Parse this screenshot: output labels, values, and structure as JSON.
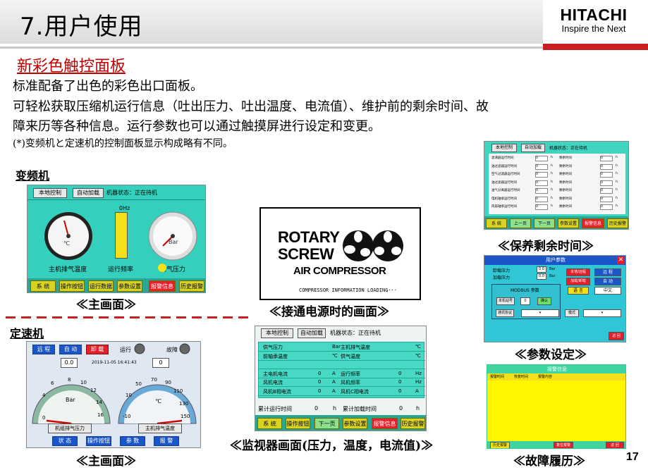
{
  "header": {
    "title": "7.用户使用",
    "logo_name": "HITACHI",
    "logo_tagline": "Inspire the Next"
  },
  "intro": {
    "subtitle": "新彩色触控面板",
    "line1": "标准配备了出色的彩色出口面板。",
    "line2": "可轻松获取压缩机运行信息（吐出压力、吐出温度、电流值）、维护前的剩余时间、故",
    "line3": "障来历等各种信息。运行参数也可以通过触摸屏进行设定和变更。",
    "note": "(*)变频机と定速机的控制面板显示构成略有不同。"
  },
  "sections": {
    "vfd": "变频机",
    "fixed": "定速机"
  },
  "captions": {
    "vfd_main": "≪主画面≫",
    "fixed_main": "≪主画面≫",
    "power_on": "≪接通电源时的画面≫",
    "monitor": "≪监视器画面(压力，温度，电流值)≫",
    "maintenance": "≪保养剩余时间≫",
    "params": "≪参数设定≫",
    "fault": "≪故障履历≫"
  },
  "vfd_panel": {
    "top_buttons": [
      "本地控制",
      "自动加载"
    ],
    "status": "机器状态：正在待机",
    "freq_label": "0Hz",
    "gauge_temp": "主机排气温度",
    "gauge_freq": "运行频率",
    "gauge_press": "供气压力",
    "temp_unit": "℃",
    "press_unit": "Bar",
    "bottom_buttons": [
      "系 统",
      "操作按钮",
      "运行数据",
      "参数设置",
      "报警信息",
      "历史报警"
    ]
  },
  "rotary": {
    "word1": "ROTARY",
    "word2": "SCREW",
    "word3": "AIR COMPRESSOR",
    "loading": "COMPRESSOR INFORMATION LOADING···"
  },
  "fixed_panel": {
    "top_buttons": [
      "远 程",
      "自 动",
      "卸 载"
    ],
    "run_label": "运行",
    "fault_label": "故障",
    "value_left": "0.0",
    "datetime": "2019-11-05  16:41:43",
    "value_right": "0",
    "gauge_left_label": "机组排气压力",
    "gauge_right_label": "主机排气温度",
    "gauge_left_unit": "Bar",
    "gauge_right_unit": "℃",
    "gauge_left_ticks": [
      "0",
      "2",
      "4",
      "6",
      "8",
      "10",
      "12",
      "14",
      "16"
    ],
    "gauge_right_ticks": [
      "-10",
      "10",
      "30",
      "50",
      "70",
      "90",
      "110",
      "130",
      "150"
    ],
    "bottom_buttons": [
      "状 态",
      "操作按钮",
      "参 数",
      "报 警"
    ]
  },
  "monitor_panel": {
    "top_buttons": [
      "本地控制",
      "自动加载"
    ],
    "status": "机器状态：正在待机",
    "rows": [
      [
        "供气压力",
        "",
        "Bar",
        "主机排气温度",
        "",
        "℃"
      ],
      [
        "前轴承温度",
        "",
        "℃",
        "供气温度",
        "",
        "℃"
      ],
      [
        "",
        "",
        "",
        "",
        "",
        ""
      ],
      [
        "主电机电流",
        "0",
        "A",
        "运行频率",
        "0",
        "Hz"
      ],
      [
        "风机电流",
        "0",
        "A",
        "风机频率",
        "0",
        "Hz"
      ],
      [
        "风机B相电流",
        "0",
        "A",
        "风机C相电流",
        "0",
        "A"
      ]
    ],
    "run_time_label": "累计运行时间",
    "run_time_val": "0",
    "run_time_unit": "h",
    "load_time_label": "累计加载时间",
    "load_time_val": "0",
    "load_time_unit": "h",
    "bottom_buttons": [
      "系 统",
      "操作按钮",
      "下一页",
      "参数设置",
      "报警信息",
      "历史报警"
    ]
  },
  "maint_panel": {
    "top_buttons": [
      "本地控制",
      "自动加载"
    ],
    "status": "机器状态：正在待机",
    "left_rows": [
      "滤清器运行时间",
      "油过滤器运行时间",
      "空气过滤器运行时间",
      "油过滤器运行时间",
      "油气分离器运行时间",
      "电机轴承运行时间",
      "风扇轴承运行时间"
    ],
    "right_rows": [
      "剩余时间",
      "剩余时间",
      "剩余时间",
      "剩余时间",
      "剩余时间",
      "剩余时间",
      "剩余时间"
    ],
    "value": "0",
    "unit": "h",
    "bottom_buttons": [
      "系 统",
      "上一页",
      "下一页",
      "参数设置",
      "报警信息",
      "历史报警"
    ]
  },
  "param_panel": {
    "title": "用户参数",
    "rows": [
      "卸载压力",
      "加载压力"
    ],
    "value": "0.0",
    "unit": "Bar",
    "modbus": "MODBUS 参数",
    "addr_label": "本机站号",
    "addr_value": "0",
    "confirm": "确认",
    "proto_label": "通讯协议",
    "mode_label": "模式",
    "right_buttons": [
      "本地/远程",
      "远 程",
      "加载/卸载",
      "自 动",
      "语 言",
      "中文"
    ],
    "back": "返 回"
  },
  "fault_panel": {
    "title": "报警信息",
    "cols": [
      "报警时间",
      "恢复时间",
      "报警内容"
    ],
    "bottom_buttons": [
      "历史报警",
      "复位报警",
      "返 回"
    ]
  },
  "page_number": "17"
}
